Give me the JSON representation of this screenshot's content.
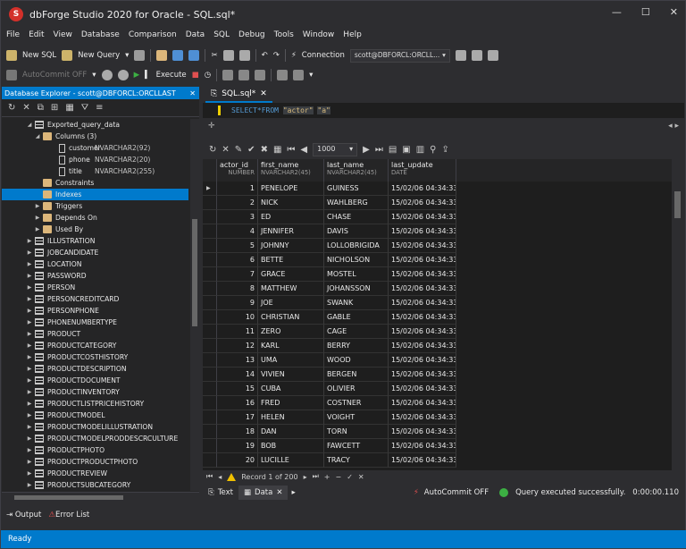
{
  "window": {
    "title": "dbForge Studio 2020 for Oracle - SQL.sql*",
    "app_icon": "S"
  },
  "menu": [
    "File",
    "Edit",
    "View",
    "Database",
    "Comparison",
    "Data",
    "SQL",
    "Debug",
    "Tools",
    "Window",
    "Help"
  ],
  "toolbar1": {
    "new_sql": "New SQL",
    "new_query": "New Query",
    "connection_label": "Connection",
    "connection_value": "scott@DBFORCL:ORCLL..."
  },
  "toolbar2": {
    "autocommit": "AutoCommit OFF",
    "execute": "Execute"
  },
  "explorer": {
    "title": "Database Explorer - scott@DBFORCL:ORCLLAST",
    "tree": [
      {
        "label": "Exported_query_data",
        "type": "table",
        "indent": 3,
        "exp": "◢"
      },
      {
        "label": "Columns (3)",
        "type": "folder",
        "indent": 4,
        "exp": "◢"
      },
      {
        "label": "customer",
        "type": "col",
        "indent": 6,
        "exp": "",
        "dtype": "NVARCHAR2(92)"
      },
      {
        "label": "phone",
        "type": "col",
        "indent": 6,
        "exp": "",
        "dtype": "NVARCHAR2(20)"
      },
      {
        "label": "title",
        "type": "col",
        "indent": 6,
        "exp": "",
        "dtype": "NVARCHAR2(255)"
      },
      {
        "label": "Constraints",
        "type": "folder",
        "indent": 4,
        "exp": ""
      },
      {
        "label": "Indexes",
        "type": "folder",
        "indent": 4,
        "exp": "",
        "selected": true
      },
      {
        "label": "Triggers",
        "type": "folder",
        "indent": 4,
        "exp": "▶"
      },
      {
        "label": "Depends On",
        "type": "folder",
        "indent": 4,
        "exp": "▶"
      },
      {
        "label": "Used By",
        "type": "folder",
        "indent": 4,
        "exp": "▶"
      },
      {
        "label": "ILLUSTRATION",
        "type": "table",
        "indent": 3,
        "exp": "▶"
      },
      {
        "label": "JOBCANDIDATE",
        "type": "table",
        "indent": 3,
        "exp": "▶"
      },
      {
        "label": "LOCATION",
        "type": "table",
        "indent": 3,
        "exp": "▶"
      },
      {
        "label": "PASSWORD",
        "type": "table",
        "indent": 3,
        "exp": "▶"
      },
      {
        "label": "PERSON",
        "type": "table",
        "indent": 3,
        "exp": "▶"
      },
      {
        "label": "PERSONCREDITCARD",
        "type": "table",
        "indent": 3,
        "exp": "▶"
      },
      {
        "label": "PERSONPHONE",
        "type": "table",
        "indent": 3,
        "exp": "▶"
      },
      {
        "label": "PHONENUMBERTYPE",
        "type": "table",
        "indent": 3,
        "exp": "▶"
      },
      {
        "label": "PRODUCT",
        "type": "table",
        "indent": 3,
        "exp": "▶"
      },
      {
        "label": "PRODUCTCATEGORY",
        "type": "table",
        "indent": 3,
        "exp": "▶"
      },
      {
        "label": "PRODUCTCOSTHISTORY",
        "type": "table",
        "indent": 3,
        "exp": "▶"
      },
      {
        "label": "PRODUCTDESCRIPTION",
        "type": "table",
        "indent": 3,
        "exp": "▶"
      },
      {
        "label": "PRODUCTDOCUMENT",
        "type": "table",
        "indent": 3,
        "exp": "▶"
      },
      {
        "label": "PRODUCTINVENTORY",
        "type": "table",
        "indent": 3,
        "exp": "▶"
      },
      {
        "label": "PRODUCTLISTPRICEHISTORY",
        "type": "table",
        "indent": 3,
        "exp": "▶"
      },
      {
        "label": "PRODUCTMODEL",
        "type": "table",
        "indent": 3,
        "exp": "▶"
      },
      {
        "label": "PRODUCTMODELILLUSTRATION",
        "type": "table",
        "indent": 3,
        "exp": "▶"
      },
      {
        "label": "PRODUCTMODELPRODDESCRCULTURE",
        "type": "table",
        "indent": 3,
        "exp": "▶"
      },
      {
        "label": "PRODUCTPHOTO",
        "type": "table",
        "indent": 3,
        "exp": "▶"
      },
      {
        "label": "PRODUCTPRODUCTPHOTO",
        "type": "table",
        "indent": 3,
        "exp": "▶"
      },
      {
        "label": "PRODUCTREVIEW",
        "type": "table",
        "indent": 3,
        "exp": "▶"
      },
      {
        "label": "PRODUCTSUBCATEGORY",
        "type": "table",
        "indent": 3,
        "exp": "▶"
      }
    ]
  },
  "editor": {
    "tab": "SQL.sql*",
    "sql": {
      "select": "SELECT",
      "star": "*",
      "from": "FROM",
      "table": "\"actor\"",
      "alias": "\"a\""
    },
    "limit": "1000"
  },
  "grid": {
    "columns": [
      {
        "name": "actor_id",
        "type": "NUMBER"
      },
      {
        "name": "first_name",
        "type": "NVARCHAR2(45)"
      },
      {
        "name": "last_name",
        "type": "NVARCHAR2(45)"
      },
      {
        "name": "last_update",
        "type": "DATE"
      }
    ],
    "rows": [
      [
        "1",
        "PENELOPE",
        "GUINESS",
        "15/02/06 04:34:33"
      ],
      [
        "2",
        "NICK",
        "WAHLBERG",
        "15/02/06 04:34:33"
      ],
      [
        "3",
        "ED",
        "CHASE",
        "15/02/06 04:34:33"
      ],
      [
        "4",
        "JENNIFER",
        "DAVIS",
        "15/02/06 04:34:33"
      ],
      [
        "5",
        "JOHNNY",
        "LOLLOBRIGIDA",
        "15/02/06 04:34:33"
      ],
      [
        "6",
        "BETTE",
        "NICHOLSON",
        "15/02/06 04:34:33"
      ],
      [
        "7",
        "GRACE",
        "MOSTEL",
        "15/02/06 04:34:33"
      ],
      [
        "8",
        "MATTHEW",
        "JOHANSSON",
        "15/02/06 04:34:33"
      ],
      [
        "9",
        "JOE",
        "SWANK",
        "15/02/06 04:34:33"
      ],
      [
        "10",
        "CHRISTIAN",
        "GABLE",
        "15/02/06 04:34:33"
      ],
      [
        "11",
        "ZERO",
        "CAGE",
        "15/02/06 04:34:33"
      ],
      [
        "12",
        "KARL",
        "BERRY",
        "15/02/06 04:34:33"
      ],
      [
        "13",
        "UMA",
        "WOOD",
        "15/02/06 04:34:33"
      ],
      [
        "14",
        "VIVIEN",
        "BERGEN",
        "15/02/06 04:34:33"
      ],
      [
        "15",
        "CUBA",
        "OLIVIER",
        "15/02/06 04:34:33"
      ],
      [
        "16",
        "FRED",
        "COSTNER",
        "15/02/06 04:34:33"
      ],
      [
        "17",
        "HELEN",
        "VOIGHT",
        "15/02/06 04:34:33"
      ],
      [
        "18",
        "DAN",
        "TORN",
        "15/02/06 04:34:33"
      ],
      [
        "19",
        "BOB",
        "FAWCETT",
        "15/02/06 04:34:33"
      ],
      [
        "20",
        "LUCILLE",
        "TRACY",
        "15/02/06 04:34:33"
      ]
    ],
    "record": "Record 1 of 200"
  },
  "result_tabs": {
    "text": "Text",
    "data": "Data"
  },
  "result_status": {
    "autocommit": "AutoCommit OFF",
    "message": "Query executed successfully.",
    "time": "0:00:00.110"
  },
  "bottom_tabs": {
    "output": "Output",
    "error_list": "Error List"
  },
  "status_bar": "Ready",
  "colors": {
    "accent": "#007acc",
    "background": "#2d2d30",
    "editor_bg": "#1e1e1e"
  }
}
